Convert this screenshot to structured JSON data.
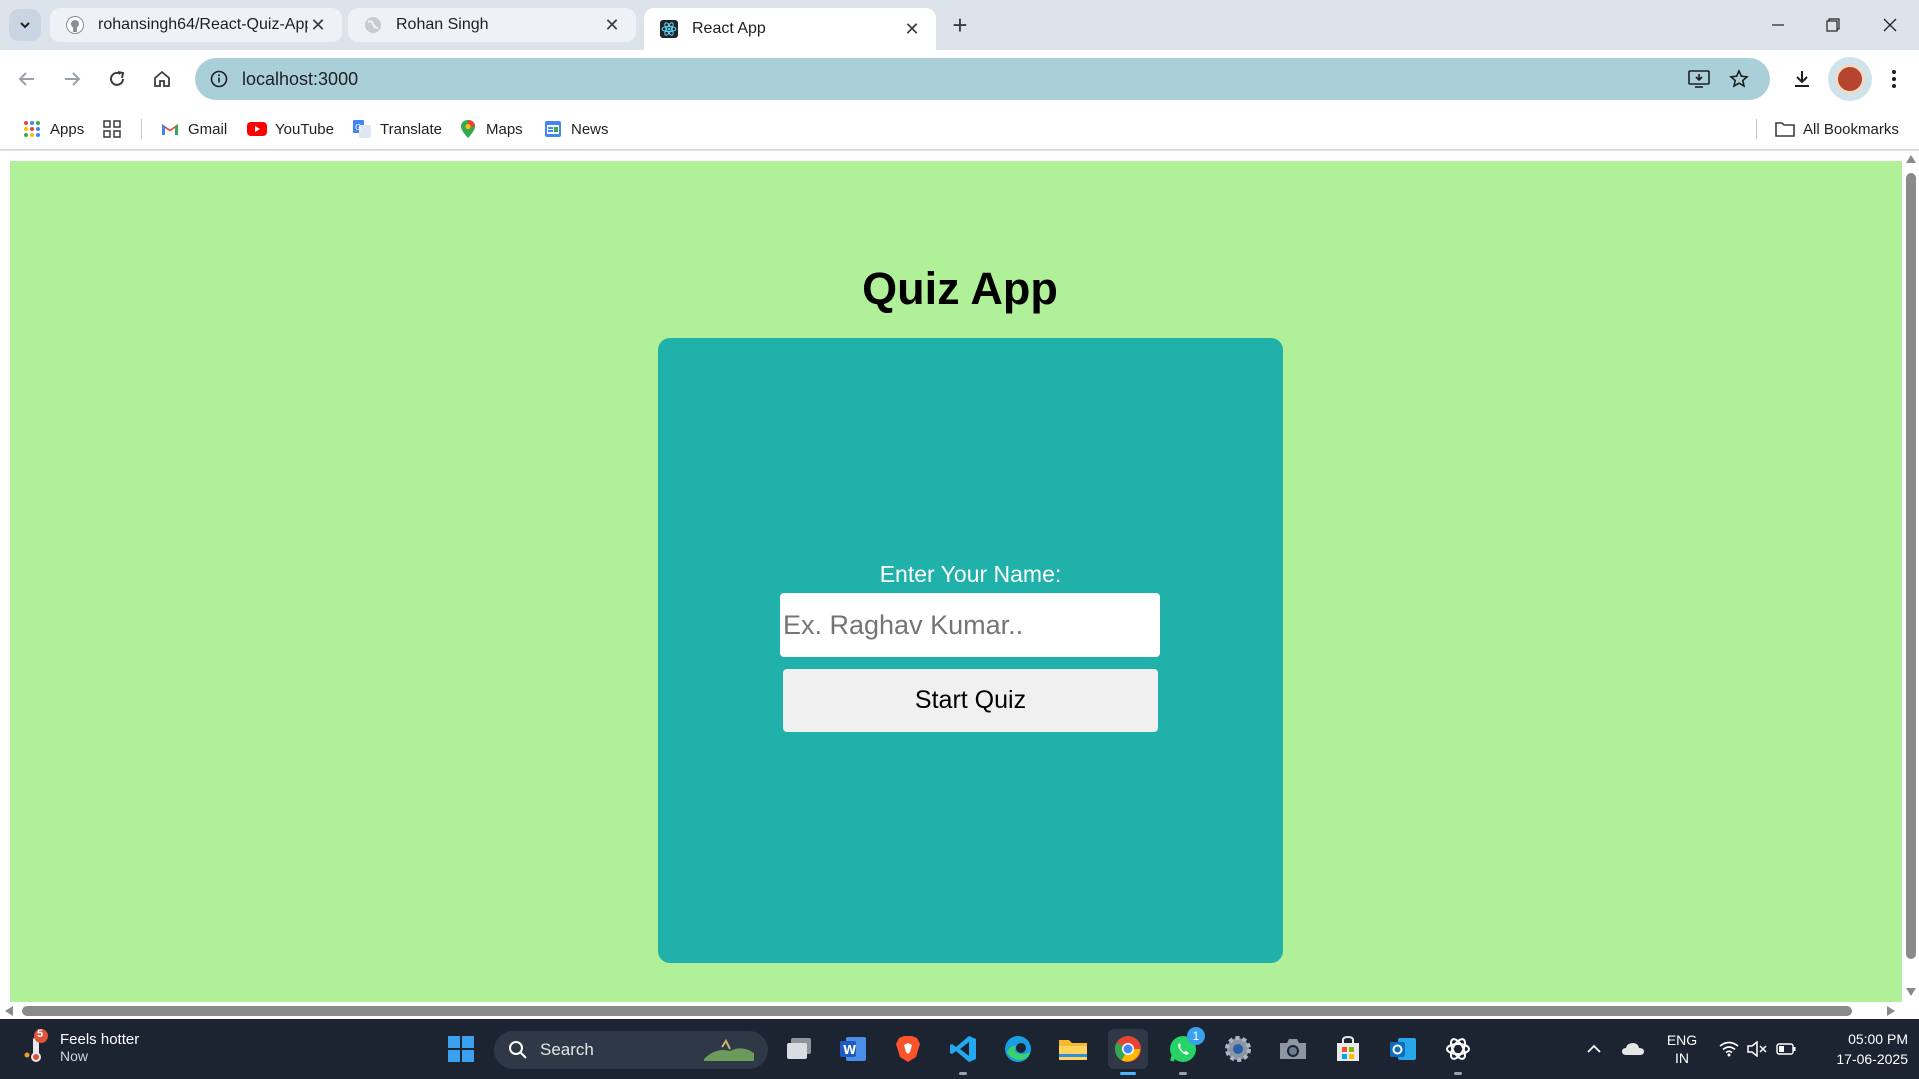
{
  "browser": {
    "tabs": [
      {
        "title": "rohansingh64/React-Quiz-App",
        "favicon": "github-icon",
        "active": false
      },
      {
        "title": "Rohan Singh",
        "favicon": "globe-icon",
        "active": false
      },
      {
        "title": "React App",
        "favicon": "react-icon",
        "active": true
      }
    ],
    "new_tab_label": "+",
    "url": "localhost:3000",
    "bookmarks": [
      {
        "label": "Apps",
        "icon": "apps-grid-icon"
      },
      {
        "label": "Gmail",
        "icon": "gmail-icon"
      },
      {
        "label": "YouTube",
        "icon": "youtube-icon"
      },
      {
        "label": "Translate",
        "icon": "translate-icon"
      },
      {
        "label": "Maps",
        "icon": "maps-pin-icon"
      },
      {
        "label": "News",
        "icon": "news-icon"
      }
    ],
    "all_bookmarks_label": "All Bookmarks"
  },
  "page": {
    "title": "Quiz App",
    "name_label": "Enter Your Name:",
    "name_placeholder": "Ex. Raghav Kumar..",
    "name_value": "",
    "start_button": "Start Quiz",
    "colors": {
      "background": "#b0f098",
      "card": "#20b2aa"
    }
  },
  "taskbar": {
    "weather_title": "Feels hotter",
    "weather_sub": "Now",
    "weather_badge": "5",
    "search_label": "Search",
    "whatsapp_badge": "1",
    "language_line1": "ENG",
    "language_line2": "IN",
    "time": "05:00 PM",
    "date": "17-06-2025"
  }
}
